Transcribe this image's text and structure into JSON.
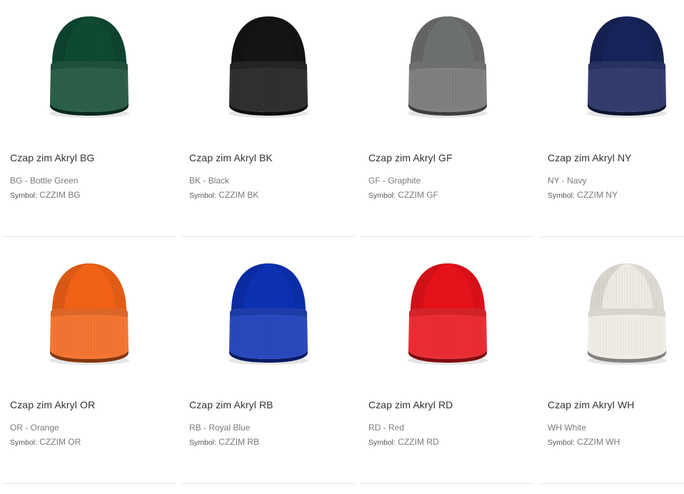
{
  "symbol_label": "Symbol:",
  "products": [
    {
      "name": "Czap zim Akryl BG",
      "color_text": "BG - Bottle Green",
      "symbol": "CZZIM BG",
      "hat_color": "#0f4a33",
      "icon": "beanie-hat-icon"
    },
    {
      "name": "Czap zim Akryl BK",
      "color_text": "BK - Black",
      "symbol": "CZZIM BK",
      "hat_color": "#151515",
      "icon": "beanie-hat-icon"
    },
    {
      "name": "Czap zim Akryl GF",
      "color_text": "GF - Graphite",
      "symbol": "CZZIM GF",
      "hat_color": "#6e716f",
      "icon": "beanie-hat-icon"
    },
    {
      "name": "Czap zim Akryl NY",
      "color_text": "NY - Navy",
      "symbol": "CZZIM NY",
      "hat_color": "#17245a",
      "icon": "beanie-hat-icon"
    },
    {
      "name": "Czap zim Akryl OR",
      "color_text": "OR - Orange",
      "symbol": "CZZIM OR",
      "hat_color": "#f36317",
      "icon": "beanie-hat-icon"
    },
    {
      "name": "Czap zim Akryl RB",
      "color_text": "RB - Royal Blue",
      "symbol": "CZZIM RB",
      "hat_color": "#0d31b4",
      "icon": "beanie-hat-icon"
    },
    {
      "name": "Czap zim Akryl RD",
      "color_text": "RD - Red",
      "symbol": "CZZIM RD",
      "hat_color": "#e8121b",
      "icon": "beanie-hat-icon"
    },
    {
      "name": "Czap zim Akryl WH",
      "color_text": "WH White",
      "symbol": "CZZIM WH",
      "hat_color": "#eeebe4",
      "icon": "beanie-hat-icon"
    }
  ]
}
